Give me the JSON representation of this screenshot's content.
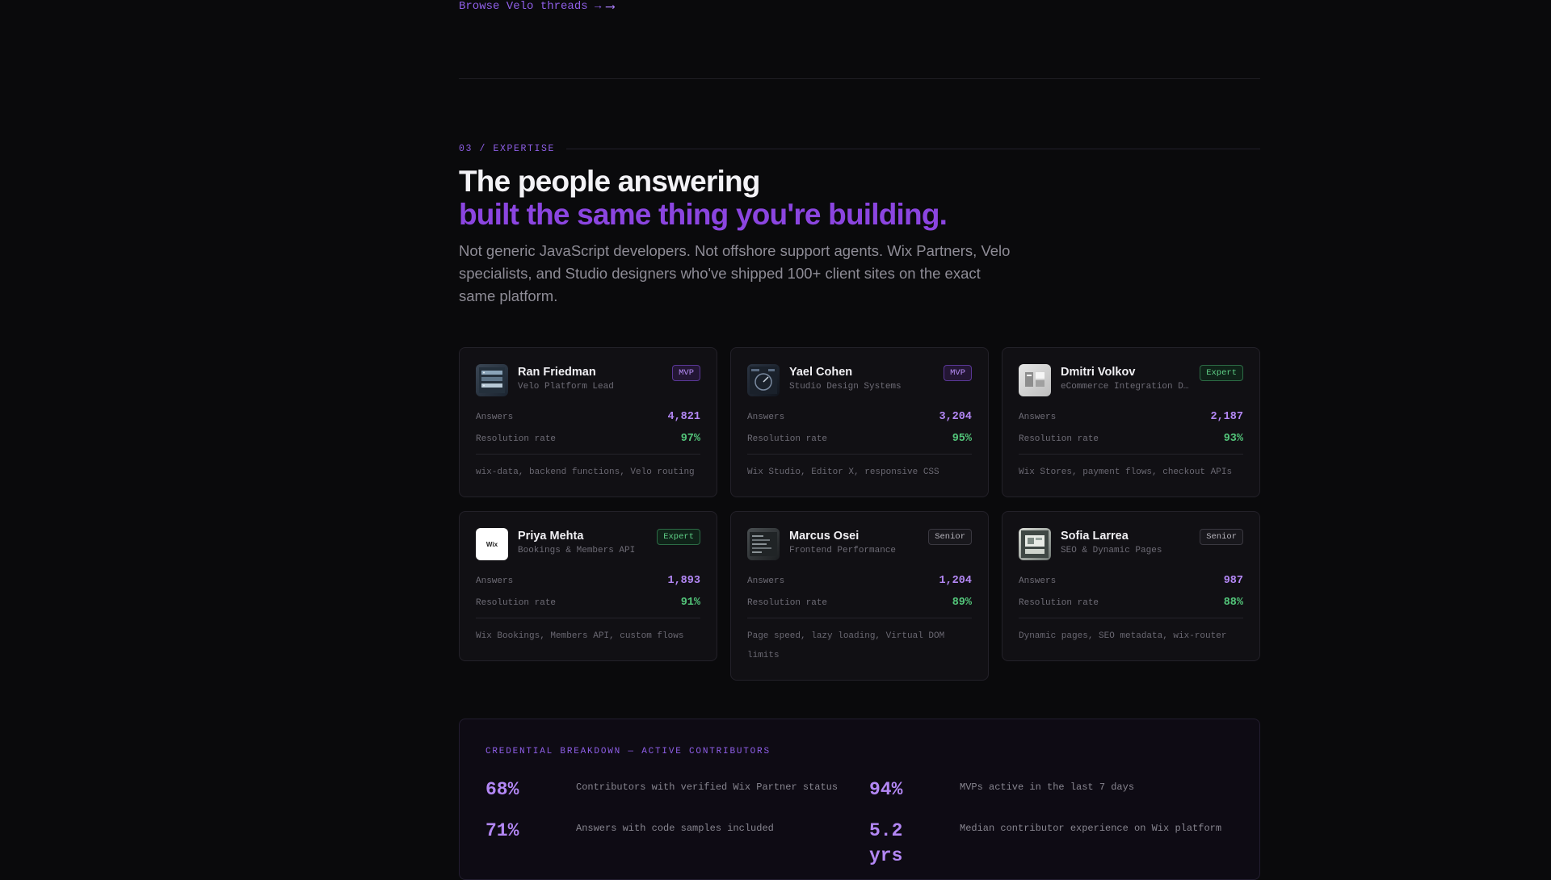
{
  "browse_link": {
    "label": "Browse Velo threads →",
    "arrow": "⟶"
  },
  "section": {
    "eyebrow": "03 / EXPERTISE",
    "headline_line1": "The people answering",
    "headline_line2": "built the same thing you're building.",
    "lede": "Not generic JavaScript developers. Not offshore support agents. Wix Partners, Velo specialists, and Studio designers who've shipped 100+ client sites on the exact same platform."
  },
  "labels": {
    "answers": "Answers",
    "resolution": "Resolution rate"
  },
  "experts": [
    {
      "name": "Ran Friedman",
      "role": "Velo Platform Lead",
      "badge": "MVP",
      "answers": "4,821",
      "resolution": "97%",
      "tags": "wix-data, backend functions, Velo routing",
      "avatar_icon": "server-rack-photo"
    },
    {
      "name": "Yael Cohen",
      "role": "Studio Design Systems",
      "badge": "MVP",
      "answers": "3,204",
      "resolution": "95%",
      "tags": "Wix Studio, Editor X, responsive CSS",
      "avatar_icon": "dashboard-photo"
    },
    {
      "name": "Dmitri Volkov",
      "role": "eCommerce Integration Dev",
      "badge": "Expert",
      "answers": "2,187",
      "resolution": "93%",
      "tags": "Wix Stores, payment flows, checkout APIs",
      "avatar_icon": "light-ui-photo"
    },
    {
      "name": "Priya Mehta",
      "role": "Bookings & Members API",
      "badge": "Expert",
      "answers": "1,893",
      "resolution": "91%",
      "tags": "Wix Bookings, Members API, custom flows",
      "avatar_icon": "wix-logo",
      "avatar_text": "Wix"
    },
    {
      "name": "Marcus Osei",
      "role": "Frontend Performance",
      "badge": "Senior",
      "answers": "1,204",
      "resolution": "89%",
      "tags": "Page speed, lazy loading, Virtual DOM limits",
      "avatar_icon": "code-screen-photo"
    },
    {
      "name": "Sofia Larrea",
      "role": "SEO & Dynamic Pages",
      "badge": "Senior",
      "answers": "987",
      "resolution": "88%",
      "tags": "Dynamic pages, SEO metadata, wix-router",
      "avatar_icon": "sketch-photo"
    }
  ],
  "credentials": {
    "title": "CREDENTIAL BREAKDOWN — ACTIVE CONTRIBUTORS",
    "items": [
      {
        "value": "68%",
        "text": "Contributors with verified Wix Partner status"
      },
      {
        "value": "94%",
        "text": "MVPs active in the last 7 days"
      },
      {
        "value": "71%",
        "text": "Answers with code samples included"
      },
      {
        "value": "5.2 yrs",
        "text": "Median contributor experience on Wix platform"
      }
    ]
  },
  "colors": {
    "accent": "#8b45e0",
    "green": "#53c57a",
    "background": "#0a0a0c"
  }
}
